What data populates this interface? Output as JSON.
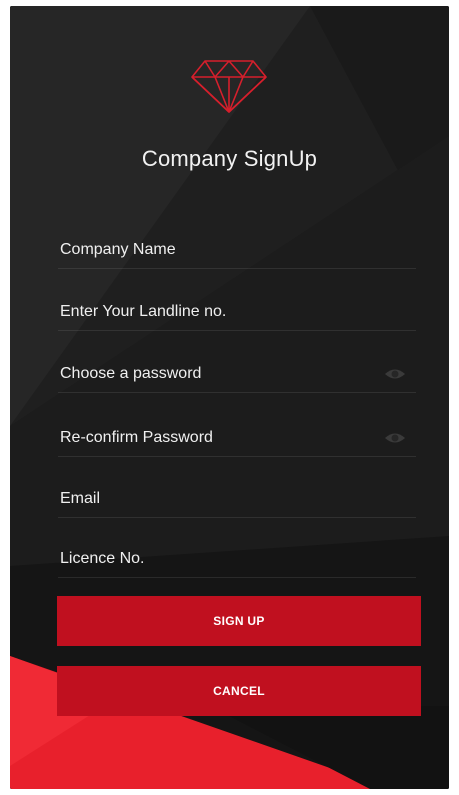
{
  "title": "Company SignUp",
  "fields": {
    "company_name": {
      "placeholder": "Company Name",
      "value": ""
    },
    "landline": {
      "placeholder": "Enter Your Landline no.",
      "value": ""
    },
    "password": {
      "placeholder": "Choose a password",
      "value": "",
      "icon": "eye-icon"
    },
    "confirm_password": {
      "placeholder": "Re-confirm Password",
      "value": "",
      "icon": "eye-icon"
    },
    "email": {
      "placeholder": "Email",
      "value": ""
    },
    "licence": {
      "placeholder": "Licence No.",
      "value": ""
    }
  },
  "buttons": {
    "sign_up": "SIGN UP",
    "cancel": "CANCEL"
  },
  "icons": {
    "logo": "diamond-logo-icon"
  },
  "colors": {
    "background": "#1f1f1f",
    "accent": "#c0101f",
    "accent_bright": "#e8202c",
    "text": "#f2f2f2"
  }
}
